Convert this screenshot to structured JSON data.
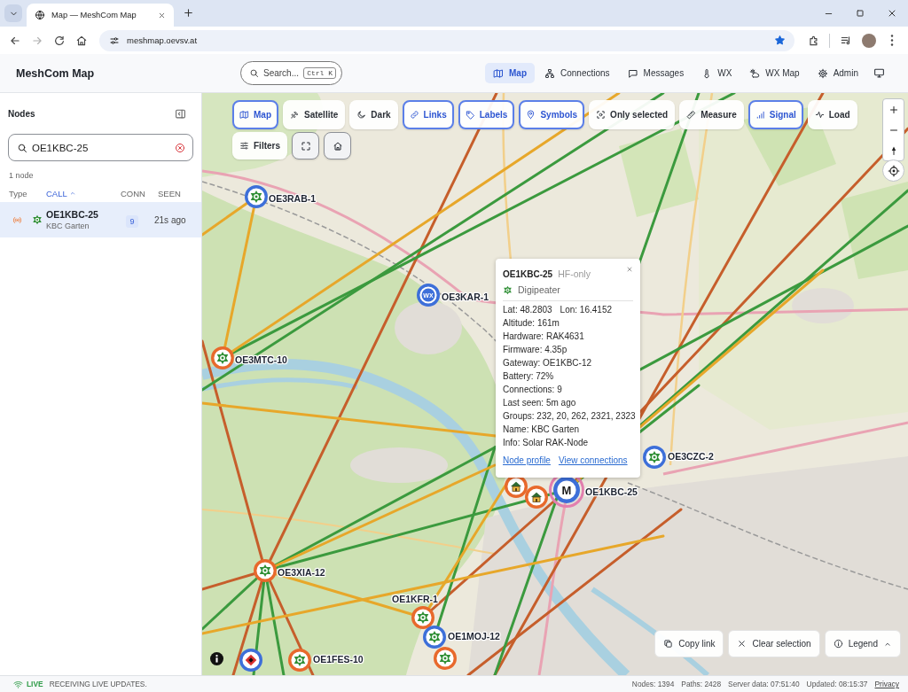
{
  "browser": {
    "tabs": [
      {
        "title": "Map — MeshCom Map",
        "selected": true
      }
    ],
    "url": "meshmap.oevsv.at",
    "bookmarked": true
  },
  "header": {
    "title": "MeshCom Map",
    "search": {
      "placeholder": "Search...",
      "shortcut": "Ctrl K"
    },
    "nav": [
      {
        "label": "Map",
        "selected": true
      },
      {
        "label": "Connections",
        "selected": false
      },
      {
        "label": "Messages",
        "selected": false
      },
      {
        "label": "WX",
        "selected": false
      },
      {
        "label": "WX Map",
        "selected": false
      },
      {
        "label": "Admin",
        "selected": false
      }
    ]
  },
  "sidebar": {
    "title": "Nodes",
    "search": {
      "value": "OE1KBC-25"
    },
    "count": "1 node",
    "columns": [
      {
        "label": "Type",
        "sorted": false
      },
      {
        "label": "CALL",
        "sorted": true
      },
      {
        "label": "CONN",
        "sorted": false
      },
      {
        "label": "SEEN",
        "sorted": false
      }
    ],
    "rows": [
      {
        "kind": "digipeater",
        "call": "OE1KBC-25",
        "name": "KBC Garten",
        "connections": "9",
        "seen": "21s ago",
        "selected": true
      }
    ]
  },
  "map": {
    "base_layers": [
      {
        "label": "Map",
        "selected": true
      },
      {
        "label": "Satellite",
        "selected": false
      },
      {
        "label": "Dark",
        "selected": false
      }
    ],
    "toggles": [
      {
        "label": "Links",
        "on": true
      },
      {
        "label": "Labels",
        "on": true
      },
      {
        "label": "Symbols",
        "on": true
      },
      {
        "label": "Only selected",
        "on": false
      },
      {
        "label": "Measure",
        "on": false
      },
      {
        "label": "Signal",
        "on": true
      },
      {
        "label": "Load",
        "on": false
      }
    ],
    "filters_button": "Filters",
    "nodes": [
      {
        "call": "OE3RAB-1",
        "kind": "digipeater",
        "color": "#3d6fd9",
        "selected": false
      },
      {
        "call": "OE3KAR-1",
        "kind": "wx",
        "symbol": "WX",
        "color": "#3d6fd9",
        "selected": false
      },
      {
        "call": "OE3MTC-10",
        "kind": "digipeater",
        "color": "#e8692c",
        "selected": false
      },
      {
        "call": "OE3CZC-2",
        "kind": "digipeater",
        "color": "#3d6fd9",
        "selected": false
      },
      {
        "kind": "house",
        "color": "#e8692c",
        "selected": false
      },
      {
        "kind": "house",
        "color": "#e8692c",
        "selected": false
      },
      {
        "call": "OE1KBC-25",
        "kind": "mobile",
        "symbol": "M",
        "color": "#3d6fd9",
        "selected": true
      },
      {
        "call": "OE3XIA-12",
        "kind": "digipeater",
        "color": "#e8692c",
        "selected": false
      },
      {
        "call": "OE1KFR-1",
        "kind": "digipeater",
        "color": "#e8692c",
        "selected": false
      },
      {
        "call": "OE1MOJ-12",
        "kind": "digipeater",
        "color": "#3d6fd9",
        "selected": false
      },
      {
        "kind": "digipeater",
        "color": "#e8692c",
        "selected": false
      },
      {
        "kind": "alert",
        "color": "#3d6fd9",
        "selected": false
      },
      {
        "call": "OE1FES-10",
        "kind": "digipeater",
        "color": "#e8692c",
        "selected": false
      }
    ],
    "popup": {
      "call": "OE1KBC-25",
      "tag": "HF-only",
      "kind": "digipeater",
      "type": "Digipeater",
      "coords": [
        "Lat: 48.2803",
        "Lon: 16.4152"
      ],
      "fields": [
        "Altitude: 161m",
        "Hardware: RAK4631",
        "Firmware: 4.35p",
        "Gateway: OE1KBC-12",
        "Battery: 72%",
        "Connections: 9",
        "Last seen: 5m ago",
        "Groups: 232, 20, 262, 2321, 2323",
        "Name: KBC Garten",
        "Info: Solar RAK-Node"
      ],
      "links": [
        "Node profile",
        "View connections"
      ]
    },
    "actions": [
      "Copy link",
      "Clear selection"
    ],
    "legend": {
      "label": "Legend"
    }
  },
  "status_bar": {
    "live": "LIVE",
    "message": "RECEIVING LIVE UPDATES.",
    "stats": [
      "Nodes: 1394",
      "Paths: 2428",
      "Server data: 07:51:40",
      "Updated: 08:15:37"
    ],
    "privacy": "Privacy"
  }
}
